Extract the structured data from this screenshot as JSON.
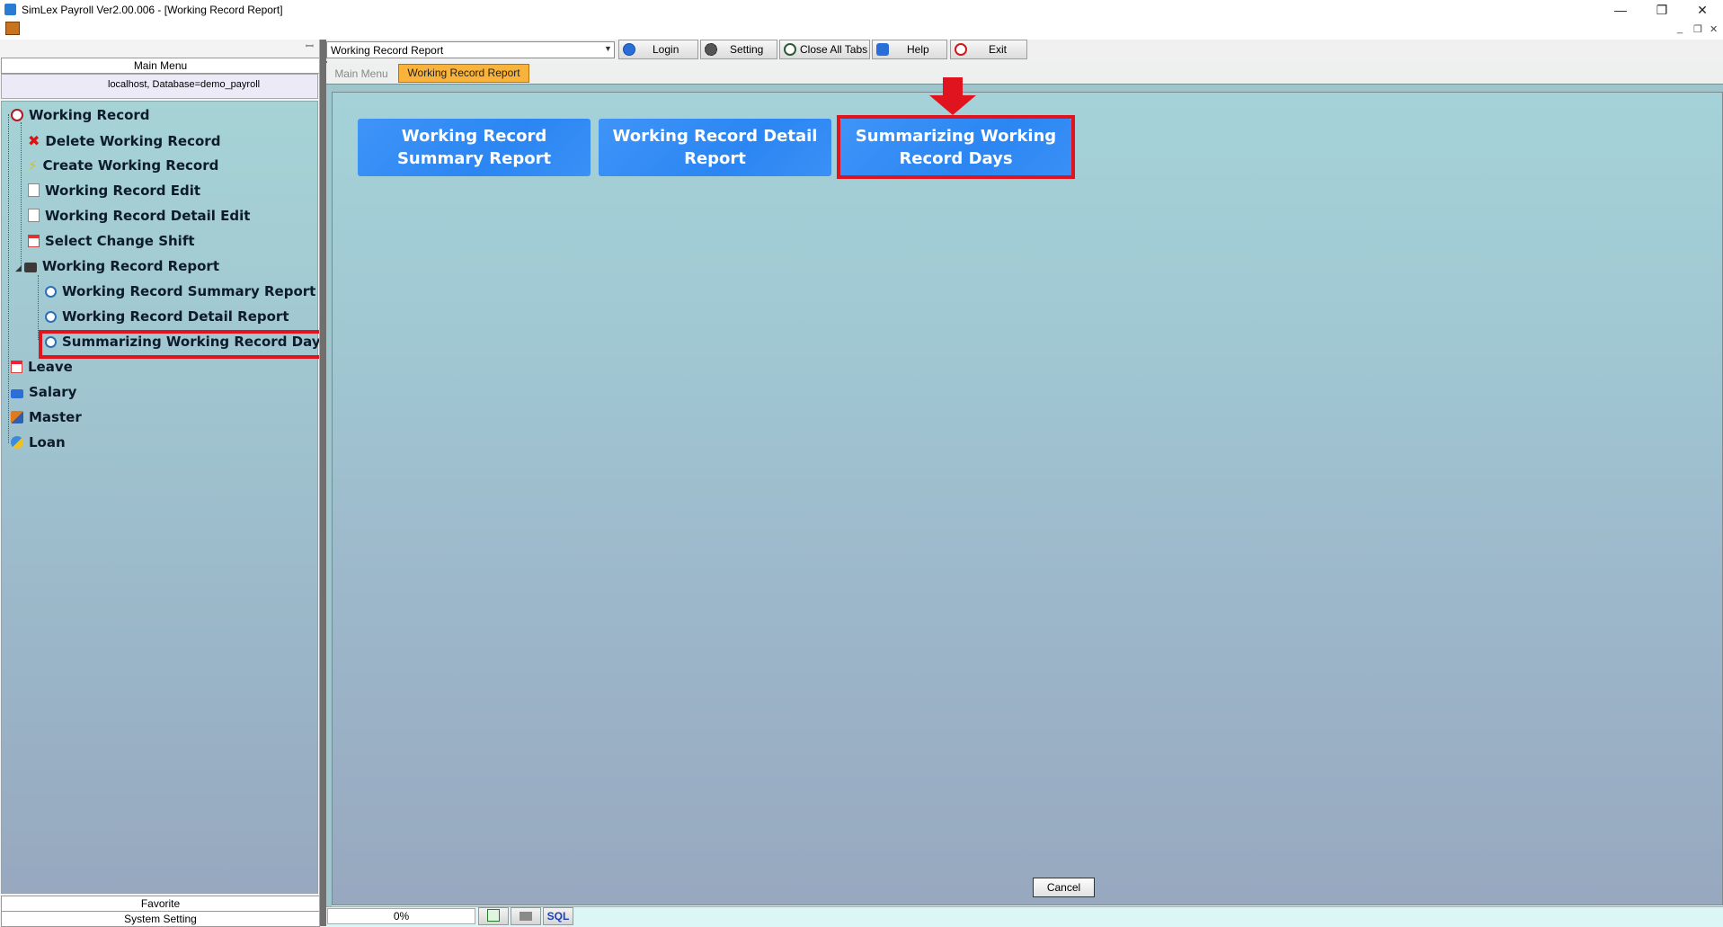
{
  "window": {
    "title": "SimLex Payroll Ver2.00.006 - [Working Record Report]",
    "minimize": "—",
    "maximize": "❐",
    "close": "✕"
  },
  "mdi": {
    "minimize": "_",
    "restore": "❐",
    "close": "✕"
  },
  "sidebar": {
    "header": "Main Menu",
    "pin": "ꟷ",
    "connection": "localhost,  Database=demo_payroll",
    "tree": [
      {
        "label": "Working Record",
        "icon": "clock-icon"
      },
      {
        "label": "Delete Working Record",
        "icon": "delete-icon"
      },
      {
        "label": "Create Working Record",
        "icon": "lightning-icon"
      },
      {
        "label": "Working Record Edit",
        "icon": "edit-document-icon"
      },
      {
        "label": "Working Record Detail Edit",
        "icon": "edit-document-icon"
      },
      {
        "label": "Select Change Shift",
        "icon": "calendar-icon"
      },
      {
        "label": "Working Record Report",
        "icon": "printer-icon"
      },
      {
        "label": "Working Record Summary Report",
        "icon": "report-search-icon"
      },
      {
        "label": "Working Record Detail Report",
        "icon": "report-search-icon"
      },
      {
        "label": "Summarizing Working Record Days",
        "icon": "report-search-icon"
      },
      {
        "label": "Leave",
        "icon": "leave-calendar-icon"
      },
      {
        "label": "Salary",
        "icon": "salary-icon"
      },
      {
        "label": "Master",
        "icon": "master-cube-icon"
      },
      {
        "label": "Loan",
        "icon": "loan-icon"
      }
    ],
    "favorite": "Favorite",
    "system_setting": "System Setting"
  },
  "toolbar": {
    "combo_value": "Working Record Report",
    "login": "Login",
    "setting": "Setting",
    "close_all_tabs": "Close All Tabs",
    "help": "Help",
    "exit": "Exit"
  },
  "tabs": [
    {
      "label": "Main Menu",
      "active": false
    },
    {
      "label": "Working Record Report",
      "active": true
    }
  ],
  "content": {
    "buttons": [
      "Working Record Summary Report",
      "Working Record Detail Report",
      "Summarizing Working Record Days"
    ],
    "cancel": "Cancel"
  },
  "status": {
    "progress": "0%",
    "sql": "SQL"
  },
  "colors": {
    "accent_tab": "#f9b33a",
    "button_blue": "#2b86f3",
    "highlight_red": "#e0141e"
  }
}
